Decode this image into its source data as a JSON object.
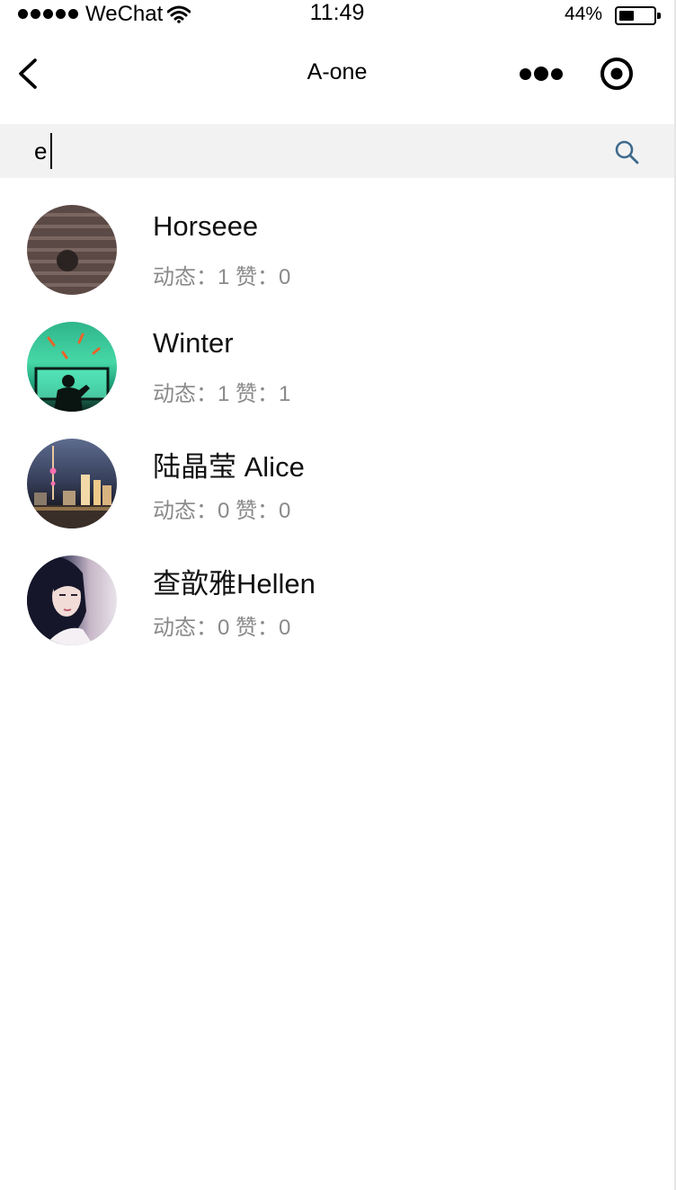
{
  "status_bar": {
    "carrier": "WeChat",
    "time": "11:49",
    "battery_percent": "44%",
    "battery_level": 0.44
  },
  "nav": {
    "title": "A-one",
    "back_icon": "chevron-left-icon",
    "more_icon": "more-dots-icon",
    "close_icon": "target-circle-icon"
  },
  "search": {
    "value": "e",
    "icon": "search-icon"
  },
  "users": [
    {
      "name": "Horseee",
      "stats": "动态：1 赞：0"
    },
    {
      "name": "Winter",
      "stats": "动态：1 赞：1"
    },
    {
      "name": "陆晶莹 Alice",
      "stats": "动态：0 赞：0"
    },
    {
      "name": "查歆雅Hellen",
      "stats": "动态：0 赞：0"
    }
  ],
  "colors": {
    "search_background": "#f2f2f2",
    "search_icon": "#3e6a8c",
    "stats_text": "#8a8a8a"
  }
}
